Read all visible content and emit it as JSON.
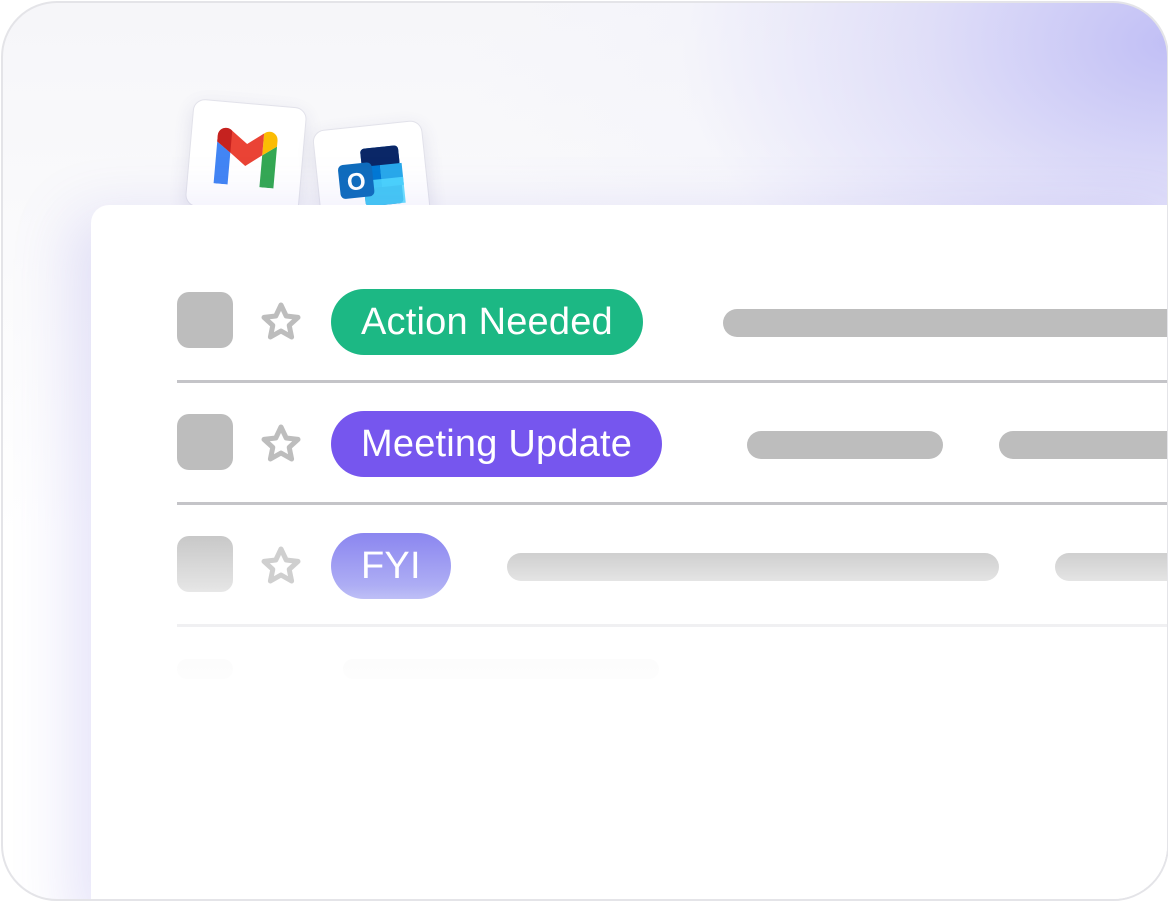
{
  "integrations": [
    {
      "name": "Gmail",
      "icon": "gmail-icon"
    },
    {
      "name": "Outlook",
      "icon": "outlook-icon",
      "letter": "O"
    }
  ],
  "emails": [
    {
      "label": "Action Needed",
      "label_color": "#1cb884",
      "starred": false,
      "checked": false
    },
    {
      "label": "Meeting Update",
      "label_color": "#7656ee",
      "starred": false,
      "checked": false
    },
    {
      "label": "FYI",
      "label_color": "#9e9bf2",
      "starred": false,
      "checked": false
    }
  ],
  "colors": {
    "placeholder_gray": "#bdbdbd",
    "accent_glow": "#bebcf5"
  }
}
